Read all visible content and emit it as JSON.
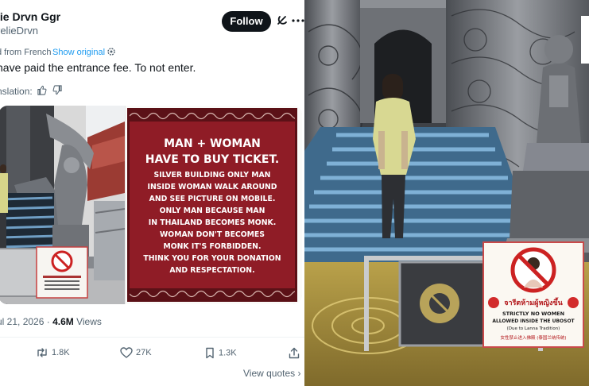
{
  "tweet": {
    "author_name": "lie Drvn Ggr",
    "author_handle": "relieDrvn",
    "follow_label": "Follow",
    "translated_from": "d from French",
    "show_original": "Show original",
    "text": "have paid the entrance fee. To not enter.",
    "rate_translation": "nslation:",
    "date": "ul 21, 2026 · ",
    "views_count": "4.6M",
    "views_label": " Views",
    "retweets": "1.8K",
    "likes": "27K",
    "bookmarks": "1.3K",
    "view_quotes": "View quotes"
  },
  "sign": {
    "title_lines": [
      "MAN + WOMAN",
      "HAVE TO BUY TICKET."
    ],
    "body_lines": [
      "SILVER BUILDING ONLY MAN",
      "INSIDE WOMAN WALK AROUND",
      "AND SEE PICTURE ON MOBILE.",
      "ONLY MAN BECAUSE MAN",
      "IN THAILAND BECOMES MONK.",
      "WOMAN DON'T BECOMES",
      "MONK IT'S FORBIDDEN.",
      "THINK YOU FOR YOUR DONATION",
      "AND RESPECTATION."
    ]
  },
  "photo_sign": {
    "thai": "จารีตห้ามผู้หญิงขึ้น",
    "line1": "STRICTLY NO WOMEN",
    "line2": "ALLOWED INSIDE THE UBOSOT",
    "line3": "(Due to Lanna Tradition)",
    "chinese": "女性禁止进入佛殿 (泰国兰纳传统)"
  },
  "colors": {
    "text_primary": "#0f1419",
    "text_secondary": "#536471",
    "link": "#1d9bf0",
    "sign_red": "#8f1c26",
    "stairs_blue": "#5f8fb4",
    "temple_silver": "#8a8d92"
  }
}
